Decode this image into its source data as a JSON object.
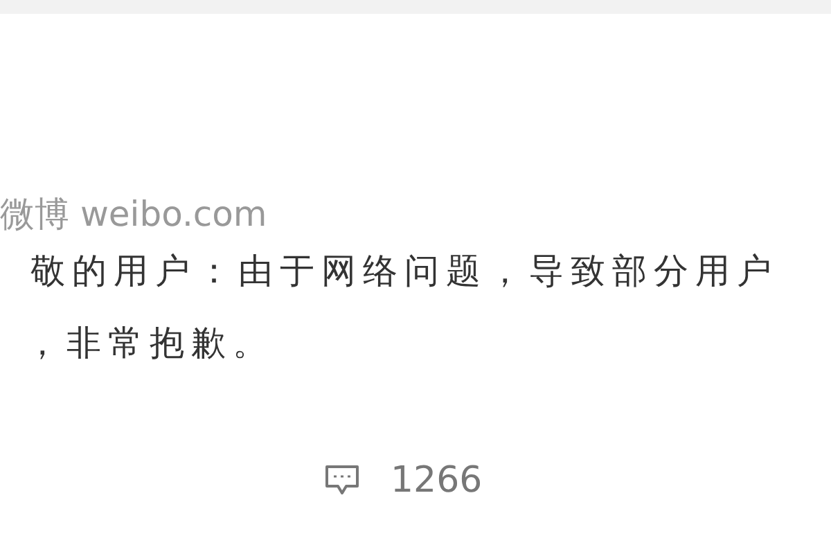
{
  "post": {
    "source": "微博 weibo.com",
    "lines": [
      "敬的用户：由于网络问题，导致部分用户",
      "，非常抱歉。"
    ],
    "comment_count": "1266"
  }
}
